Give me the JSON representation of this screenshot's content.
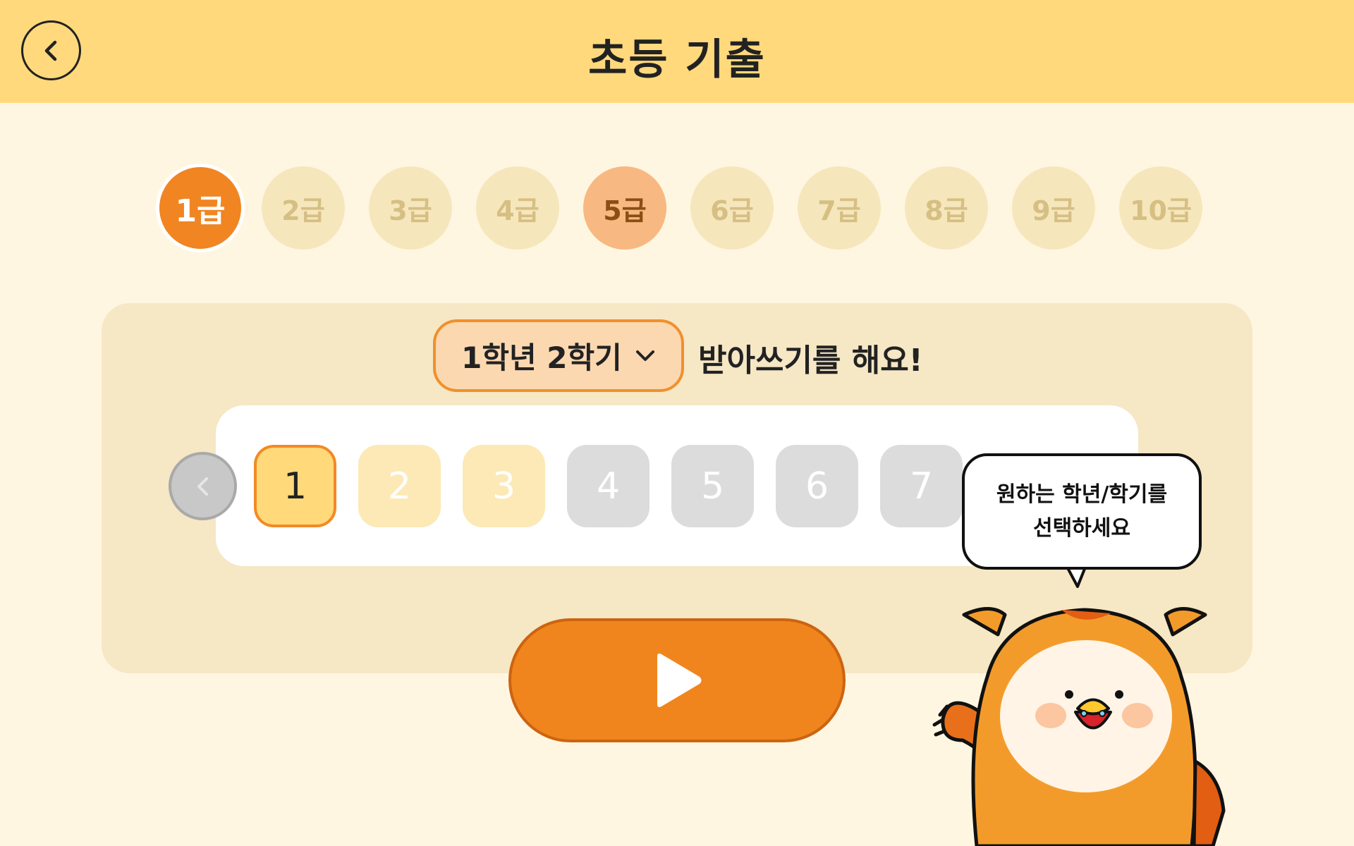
{
  "header": {
    "title": "초등 기출",
    "back_icon": "chevron-left-icon"
  },
  "levels": [
    {
      "label": "1급",
      "state": "active"
    },
    {
      "label": "2급",
      "state": "locked"
    },
    {
      "label": "3급",
      "state": "locked"
    },
    {
      "label": "4급",
      "state": "locked"
    },
    {
      "label": "5급",
      "state": "partial"
    },
    {
      "label": "6급",
      "state": "locked"
    },
    {
      "label": "7급",
      "state": "locked"
    },
    {
      "label": "8급",
      "state": "locked"
    },
    {
      "label": "9급",
      "state": "locked"
    },
    {
      "label": "10급",
      "state": "locked"
    }
  ],
  "selector": {
    "value": "1학년 2학기",
    "suffix": "받아쓰기를 해요!"
  },
  "units": [
    {
      "label": "1",
      "state": "active"
    },
    {
      "label": "2",
      "state": "done"
    },
    {
      "label": "3",
      "state": "done"
    },
    {
      "label": "4",
      "state": "locked"
    },
    {
      "label": "5",
      "state": "locked"
    },
    {
      "label": "6",
      "state": "locked"
    },
    {
      "label": "7",
      "state": "locked"
    }
  ],
  "tooltip": {
    "line1": "원하는 학년/학기를",
    "line2": "선택하세요"
  },
  "colors": {
    "header": "#ffd97c",
    "background": "#fff6e1",
    "accent": "#f0851e",
    "panel": "#f6e7c5"
  }
}
